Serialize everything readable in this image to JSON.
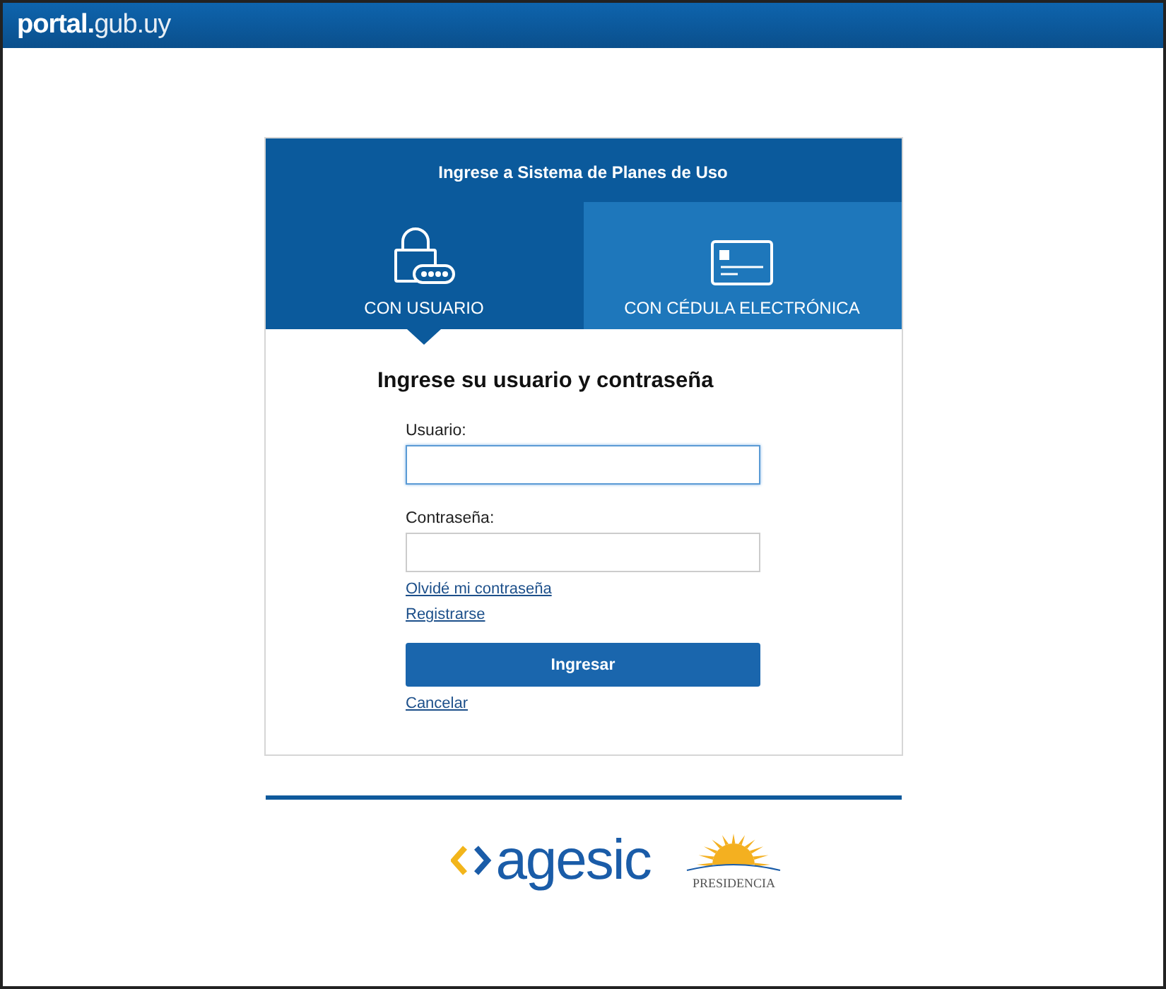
{
  "header": {
    "logo_bold": "portal.",
    "logo_light": "gub.uy"
  },
  "login": {
    "title": "Ingrese a Sistema de Planes de Uso",
    "tabs": [
      {
        "label": "CON USUARIO",
        "kind": "lock",
        "selected": true
      },
      {
        "label": "CON CÉDULA ELECTRÓNICA",
        "kind": "card",
        "selected": false
      }
    ],
    "heading": "Ingrese su usuario y contraseña",
    "fields": [
      {
        "label": "Usuario:",
        "focused": true
      },
      {
        "label": "Contraseña:",
        "focused": false
      }
    ],
    "links": [
      "Olvidé mi contraseña",
      "Registrarse"
    ],
    "submit": "Ingresar",
    "cancel": "Cancelar"
  },
  "footer": {
    "agesic": "agesic",
    "presidencia": "PRESIDENCIA"
  }
}
